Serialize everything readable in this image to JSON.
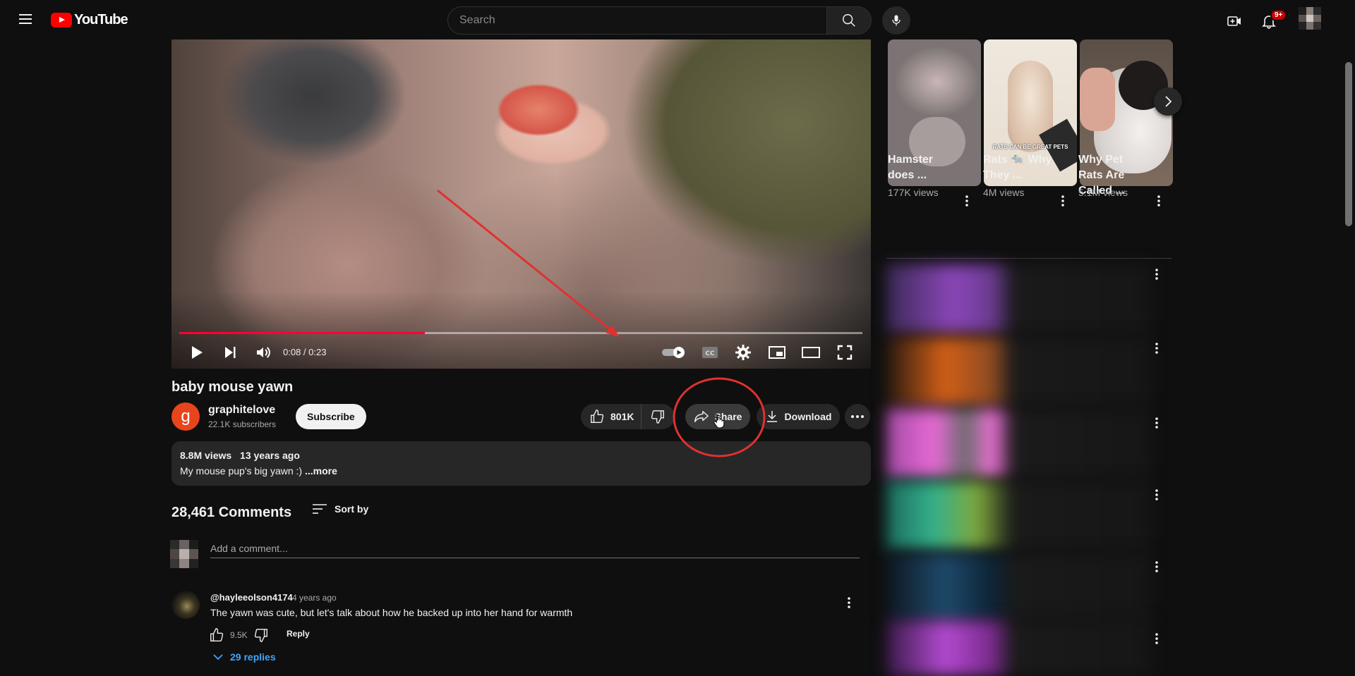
{
  "header": {
    "logo_text": "YouTube",
    "search_placeholder": "Search",
    "notification_count": "9+"
  },
  "player": {
    "time": "0:08 / 0:23",
    "progress": 0.36
  },
  "video": {
    "title": "baby mouse yawn",
    "channel_initial": "g",
    "channel_name": "graphitelove",
    "subscribers": "22.1K subscribers",
    "subscribe_label": "Subscribe",
    "likes": "801K",
    "share_label": "Share",
    "download_label": "Download"
  },
  "description": {
    "views": "8.8M views",
    "age": "13 years ago",
    "text": "My mouse pup's big yawn :)",
    "more": "...more"
  },
  "comments": {
    "count_label": "28,461 Comments",
    "sort_label": "Sort by",
    "add_placeholder": "Add a comment...",
    "items": [
      {
        "author": "@hayleeolson4174",
        "time": "4 years ago",
        "text": "The yawn was cute, but let's talk about how he backed up into her hand for warmth",
        "likes": "9.5K",
        "reply_label": "Reply",
        "replies_label": "29 replies"
      }
    ]
  },
  "shorts": [
    {
      "title": "Hamster does ...",
      "views": "177K views"
    },
    {
      "title": "Rats 🐀 Why They ...",
      "views": "4M views",
      "overlay": "RATS CAN BE GREAT PETS"
    },
    {
      "title": "Why Pet Rats Are Called ...",
      "views": "5.1M views"
    }
  ],
  "colors": {
    "background": "#0f0f0f",
    "brand_red": "#ff0000",
    "progress_red": "#ff0033",
    "link_blue": "#3ea6ff",
    "annotation_red": "#e03131"
  }
}
